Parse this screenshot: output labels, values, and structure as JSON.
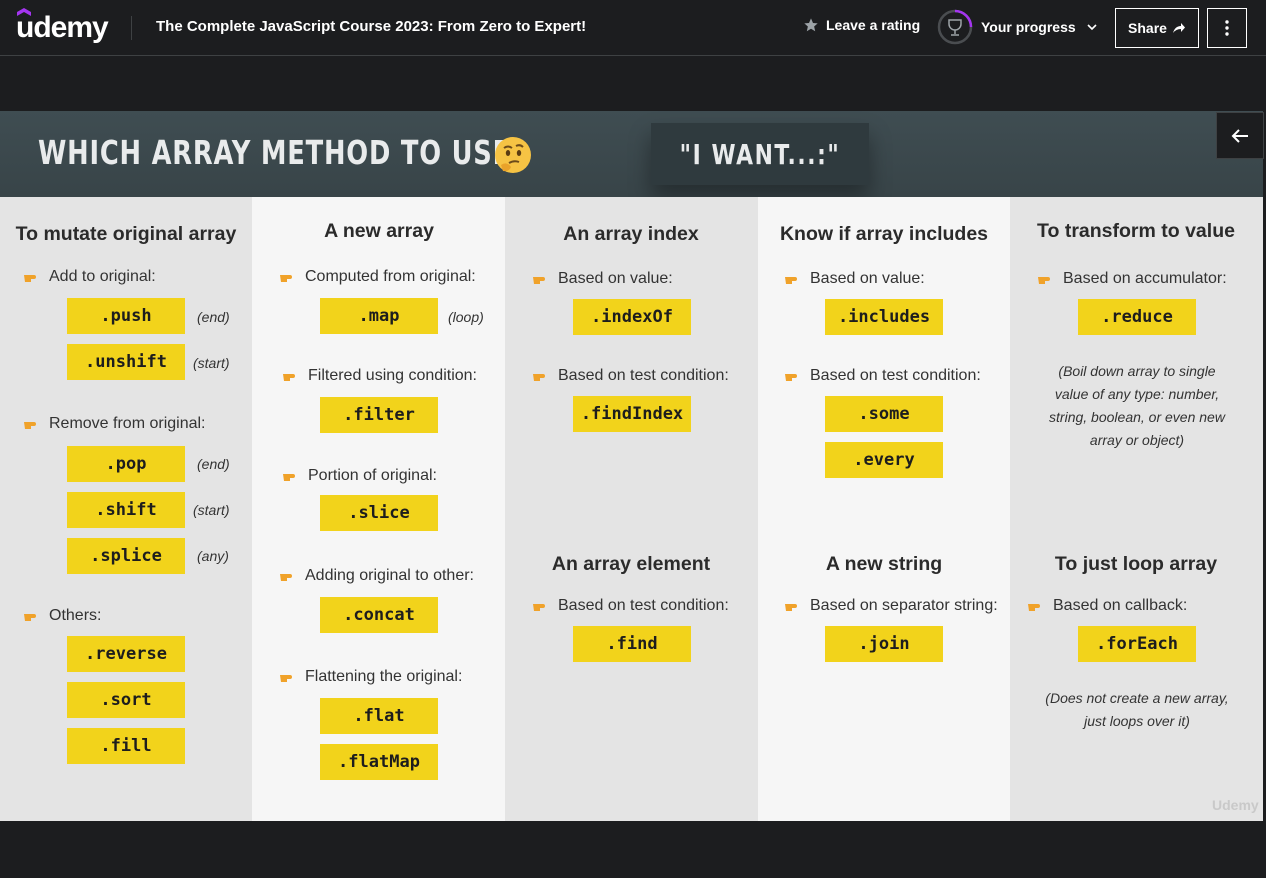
{
  "header": {
    "logo": "udemy",
    "course_title": "The Complete JavaScript Course 2023: From Zero to Expert!",
    "rating_label": "Leave a rating",
    "progress_label": "Your progress",
    "share_label": "Share"
  },
  "slide": {
    "heading": "WHICH ARRAY METHOD TO USE?",
    "iwant": "\"I WANT...:\"",
    "watermark": "Udemy",
    "columns": {
      "mutate": {
        "title": "To mutate original array",
        "add_label": "Add to original:",
        "push": ".push",
        "push_note": "(end)",
        "unshift": ".unshift",
        "unshift_note": "(start)",
        "remove_label": "Remove from original:",
        "pop": ".pop",
        "pop_note": "(end)",
        "shift": ".shift",
        "shift_note": "(start)",
        "splice": ".splice",
        "splice_note": "(any)",
        "others_label": "Others:",
        "reverse": ".reverse",
        "sort": ".sort",
        "fill": ".fill"
      },
      "new_array": {
        "title": "A new array",
        "computed_label": "Computed from original:",
        "map": ".map",
        "map_note": "(loop)",
        "filtered_label": "Filtered using condition:",
        "filter": ".filter",
        "portion_label": "Portion of original:",
        "slice": ".slice",
        "adding_label": "Adding original to other:",
        "concat": ".concat",
        "flatten_label": "Flattening the original:",
        "flat": ".flat",
        "flatMap": ".flatMap"
      },
      "index": {
        "title": "An array index",
        "value_label": "Based on value:",
        "indexOf": ".indexOf",
        "test_label": "Based on test condition:",
        "findIndex": ".findIndex"
      },
      "element": {
        "title": "An array element",
        "test_label": "Based on test condition:",
        "find": ".find"
      },
      "includes": {
        "title": "Know if array includes",
        "value_label": "Based on value:",
        "includes": ".includes",
        "test_label": "Based on test condition:",
        "some": ".some",
        "every": ".every"
      },
      "string": {
        "title": "A new string",
        "sep_label": "Based on separator string:",
        "join": ".join"
      },
      "transform": {
        "title": "To transform to value",
        "acc_label": "Based on accumulator:",
        "reduce": ".reduce",
        "reduce_note": "(Boil down array to single value of any type: number, string, boolean, or even new array or object)"
      },
      "loop": {
        "title": "To just loop array",
        "cb_label": "Based on callback:",
        "forEach": ".forEach",
        "forEach_note": "(Does not create a new array, just loops over it)"
      }
    }
  }
}
